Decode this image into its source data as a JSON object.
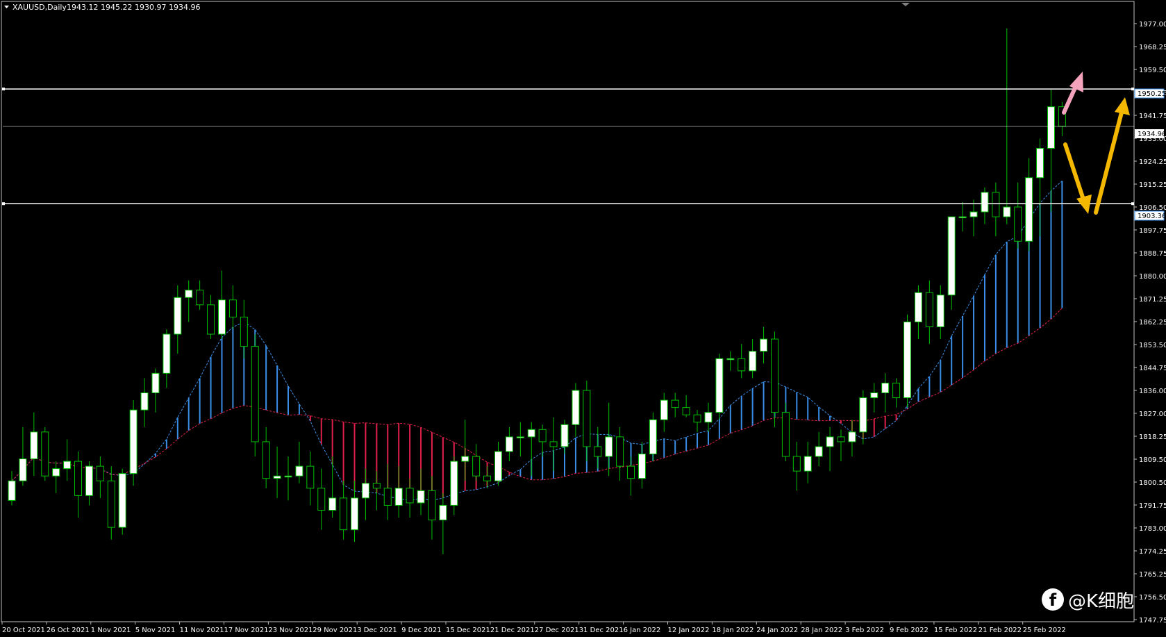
{
  "header": {
    "symbol": "XAUUSD,Daily",
    "ohlc": "1943.12 1945.22 1930.97 1934.96"
  },
  "price_scale": [
    "1977.00",
    "1968.25",
    "1959.50",
    "1950.25",
    "1941.75",
    "1933.00",
    "1924.25",
    "1915.25",
    "1906.50",
    "1897.75",
    "1888.75",
    "1880.00",
    "1871.25",
    "1862.25",
    "1853.50",
    "1844.75",
    "1836.00",
    "1827.00",
    "1818.25",
    "1809.50",
    "1800.50",
    "1791.75",
    "1783.00",
    "1774.25",
    "1765.25",
    "1756.50",
    "1747.75"
  ],
  "date_scale": [
    "20 Oct 2021",
    "26 Oct 2021",
    "1 Nov 2021",
    "5 Nov 2021",
    "11 Nov 2021",
    "17 Nov 2021",
    "23 Nov 2021",
    "29 Nov 2021",
    "3 Dec 2021",
    "9 Dec 2021",
    "15 Dec 2021",
    "21 Dec 2021",
    "27 Dec 2021",
    "31 Dec 2021",
    "6 Jan 2022",
    "12 Jan 2022",
    "18 Jan 2022",
    "24 Jan 2022",
    "28 Jan 2022",
    "3 Feb 2022",
    "9 Feb 2022",
    "15 Feb 2022",
    "21 Feb 2022",
    "25 Feb 2022"
  ],
  "price_tags": {
    "upper_level": "1950.25",
    "current_price": "1934.96",
    "lower_level": "1903.36"
  },
  "watermark": {
    "logo_letter": "f",
    "text": "@K细胞"
  },
  "colors": {
    "background": "#000000",
    "bull_body": "#ffffff",
    "wick": "#00c000",
    "cloud_bull": "#3a8ee6",
    "cloud_bear": "#e0204a",
    "level_line": "#ffffff",
    "arrow_down": "#f5b800",
    "arrow_up": "#f5b800",
    "arrow_pink": "#f4a3bd"
  },
  "chart_data": {
    "type": "candlestick",
    "symbol": "XAUUSD",
    "timeframe": "Daily",
    "ylim": [
      1747.75,
      1982.0
    ],
    "horizontal_levels": [
      1950.25,
      1903.36,
      1934.96
    ],
    "candles": [
      [
        1782,
        1794,
        1780,
        1790
      ],
      [
        1790,
        1812,
        1788,
        1799
      ],
      [
        1799,
        1818,
        1792,
        1810
      ],
      [
        1810,
        1812,
        1790,
        1792
      ],
      [
        1792,
        1798,
        1785,
        1795
      ],
      [
        1795,
        1807,
        1790,
        1798
      ],
      [
        1798,
        1802,
        1775,
        1784
      ],
      [
        1784,
        1798,
        1780,
        1796
      ],
      [
        1796,
        1800,
        1783,
        1790
      ],
      [
        1790,
        1796,
        1766,
        1771
      ],
      [
        1771,
        1795,
        1768,
        1793
      ],
      [
        1793,
        1823,
        1788,
        1819
      ],
      [
        1819,
        1832,
        1812,
        1826
      ],
      [
        1826,
        1836,
        1818,
        1834
      ],
      [
        1834,
        1852,
        1828,
        1850
      ],
      [
        1850,
        1870,
        1842,
        1865
      ],
      [
        1865,
        1872,
        1855,
        1868
      ],
      [
        1868,
        1872,
        1860,
        1862
      ],
      [
        1862,
        1866,
        1848,
        1850
      ],
      [
        1850,
        1876,
        1848,
        1864
      ],
      [
        1864,
        1870,
        1852,
        1857
      ],
      [
        1857,
        1864,
        1840,
        1845
      ],
      [
        1845,
        1850,
        1800,
        1806
      ],
      [
        1806,
        1812,
        1787,
        1791
      ],
      [
        1791,
        1804,
        1783,
        1792
      ],
      [
        1792,
        1800,
        1782,
        1792
      ],
      [
        1792,
        1806,
        1789,
        1796
      ],
      [
        1796,
        1802,
        1780,
        1787
      ],
      [
        1787,
        1795,
        1770,
        1778
      ],
      [
        1778,
        1800,
        1775,
        1783
      ],
      [
        1783,
        1790,
        1766,
        1770
      ],
      [
        1770,
        1790,
        1765,
        1783
      ],
      [
        1783,
        1795,
        1774,
        1789
      ],
      [
        1789,
        1794,
        1778,
        1787
      ],
      [
        1787,
        1797,
        1774,
        1780
      ],
      [
        1780,
        1796,
        1775,
        1787
      ],
      [
        1787,
        1791,
        1775,
        1781
      ],
      [
        1781,
        1795,
        1776,
        1786
      ],
      [
        1786,
        1792,
        1766,
        1774
      ],
      [
        1774,
        1785,
        1760,
        1780
      ],
      [
        1780,
        1800,
        1776,
        1798
      ],
      [
        1798,
        1815,
        1790,
        1800
      ],
      [
        1800,
        1805,
        1790,
        1792
      ],
      [
        1792,
        1796,
        1787,
        1790
      ],
      [
        1790,
        1806,
        1788,
        1802
      ],
      [
        1802,
        1812,
        1798,
        1808
      ],
      [
        1808,
        1814,
        1800,
        1808
      ],
      [
        1808,
        1814,
        1792,
        1811
      ],
      [
        1811,
        1813,
        1800,
        1806
      ],
      [
        1806,
        1816,
        1794,
        1804
      ],
      [
        1804,
        1815,
        1801,
        1813
      ],
      [
        1813,
        1830,
        1808,
        1827
      ],
      [
        1827,
        1831,
        1798,
        1804
      ],
      [
        1804,
        1812,
        1795,
        1800
      ],
      [
        1800,
        1822,
        1792,
        1808
      ],
      [
        1808,
        1812,
        1790,
        1796
      ],
      [
        1796,
        1800,
        1784,
        1791
      ],
      [
        1791,
        1806,
        1787,
        1801
      ],
      [
        1801,
        1818,
        1798,
        1815
      ],
      [
        1815,
        1826,
        1810,
        1823
      ],
      [
        1823,
        1826,
        1816,
        1820
      ],
      [
        1820,
        1825,
        1816,
        1817
      ],
      [
        1817,
        1819,
        1810,
        1814
      ],
      [
        1814,
        1822,
        1810,
        1818
      ],
      [
        1818,
        1842,
        1815,
        1840
      ],
      [
        1840,
        1843,
        1835,
        1840
      ],
      [
        1840,
        1846,
        1832,
        1835
      ],
      [
        1835,
        1848,
        1832,
        1843
      ],
      [
        1843,
        1853,
        1838,
        1848
      ],
      [
        1848,
        1851,
        1812,
        1818
      ],
      [
        1818,
        1822,
        1798,
        1800
      ],
      [
        1800,
        1806,
        1786,
        1794
      ],
      [
        1794,
        1806,
        1789,
        1800
      ],
      [
        1800,
        1810,
        1796,
        1804
      ],
      [
        1804,
        1812,
        1794,
        1808
      ],
      [
        1808,
        1811,
        1798,
        1806
      ],
      [
        1806,
        1815,
        1800,
        1810
      ],
      [
        1810,
        1827,
        1805,
        1824
      ],
      [
        1824,
        1830,
        1818,
        1826
      ],
      [
        1826,
        1834,
        1818,
        1830
      ],
      [
        1830,
        1832,
        1820,
        1824
      ],
      [
        1824,
        1858,
        1820,
        1855
      ],
      [
        1855,
        1870,
        1848,
        1867
      ],
      [
        1867,
        1872,
        1846,
        1853
      ],
      [
        1853,
        1870,
        1848,
        1866
      ],
      [
        1866,
        1898,
        1860,
        1898
      ],
      [
        1898,
        1904,
        1892,
        1898
      ],
      [
        1898,
        1905,
        1890,
        1900
      ],
      [
        1900,
        1910,
        1895,
        1908
      ],
      [
        1908,
        1912,
        1890,
        1898
      ],
      [
        1898,
        1975,
        1895,
        1902
      ],
      [
        1902,
        1912,
        1885,
        1888
      ],
      [
        1888,
        1922,
        1884,
        1914
      ],
      [
        1914,
        1930,
        1890,
        1926
      ],
      [
        1926,
        1950,
        1900,
        1943
      ],
      [
        1943,
        1945,
        1931,
        1935
      ]
    ]
  }
}
